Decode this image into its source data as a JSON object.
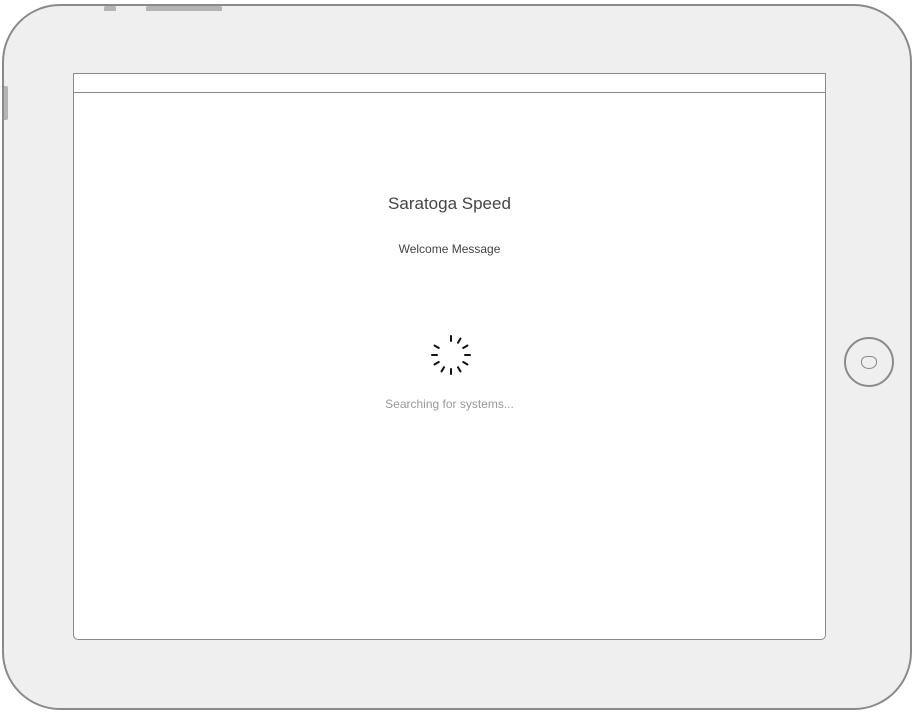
{
  "app": {
    "title": "Saratoga Speed",
    "welcome_message": "Welcome Message"
  },
  "loading": {
    "status_text": "Searching for systems...",
    "spinner_icon": "loading-spinner-icon"
  },
  "device": {
    "frame_color": "#efefef",
    "outline_color": "#8a8a8a"
  }
}
